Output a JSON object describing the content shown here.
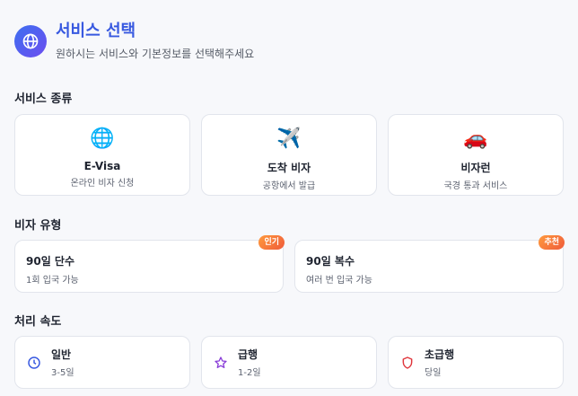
{
  "header": {
    "title": "서비스 선택",
    "subtitle": "원하시는 서비스와 기본정보를 선택해주세요",
    "icon": "globe-icon"
  },
  "service_section": {
    "title": "서비스 종류",
    "items": [
      {
        "icon": "globe-icon",
        "glyph": "🌐",
        "name": "E-Visa",
        "desc": "온라인 비자 신청"
      },
      {
        "icon": "airplane-icon",
        "glyph": "✈️",
        "name": "도착 비자",
        "desc": "공항에서 발급"
      },
      {
        "icon": "car-icon",
        "glyph": "🚗",
        "name": "비자런",
        "desc": "국경 통과 서비스"
      }
    ]
  },
  "visa_section": {
    "title": "비자 유형",
    "items": [
      {
        "name": "90일 단수",
        "desc": "1회 입국 가능",
        "badge": "인기"
      },
      {
        "name": "90일 복수",
        "desc": "여러 번 입국 가능",
        "badge": "추천"
      }
    ]
  },
  "speed_section": {
    "title": "처리 속도",
    "items": [
      {
        "icon": "clock-icon",
        "name": "일반",
        "desc": "3-5일",
        "color": "#3859e0"
      },
      {
        "icon": "star-icon",
        "name": "급행",
        "desc": "1-2일",
        "color": "#8a3fd8"
      },
      {
        "icon": "shield-icon",
        "name": "초급행",
        "desc": "당일",
        "color": "#e0363c"
      }
    ]
  },
  "colors": {
    "accent": "#3859e0",
    "badge_gradient_start": "#ff9a3c",
    "badge_gradient_end": "#ef5b3b"
  }
}
